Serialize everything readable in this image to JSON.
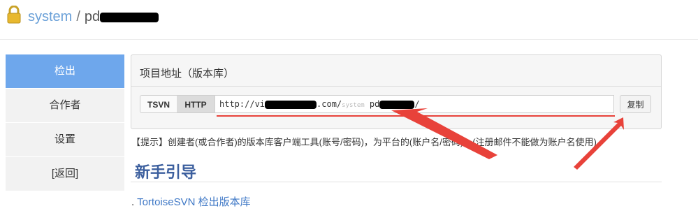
{
  "header": {
    "owner": "system",
    "separator": "/",
    "repo_prefix": "pd",
    "lock_icon": "lock-icon"
  },
  "sidebar": {
    "items": [
      {
        "label": "检出",
        "active": true
      },
      {
        "label": "合作者",
        "active": false
      },
      {
        "label": "设置",
        "active": false
      },
      {
        "label": "[返回]",
        "active": false
      }
    ]
  },
  "panel": {
    "title": "项目地址（版本库）",
    "protocols": {
      "tsvn": "TSVN",
      "http": "HTTP",
      "selected": "HTTP"
    },
    "url": {
      "prefix": "http://vi",
      "mid": ".com/",
      "faded": "system",
      "repo": "pd",
      "suffix": "/"
    },
    "copy_label": "复制"
  },
  "tip": "【提示】创建者(或合作者)的版本库客户端工具(账号/密码)，为平台的(账户名/密码)。(注册邮件不能做为账户名使用)",
  "guide": {
    "title": "新手引导",
    "link_prefix": ".",
    "link_text": "TortoiseSVN 检出版本库"
  },
  "colors": {
    "sidebar_active": "#6ea7ec",
    "annotation_red": "#e8423a",
    "guide_title": "#3c5f9e",
    "link_blue": "#3f78c6"
  }
}
